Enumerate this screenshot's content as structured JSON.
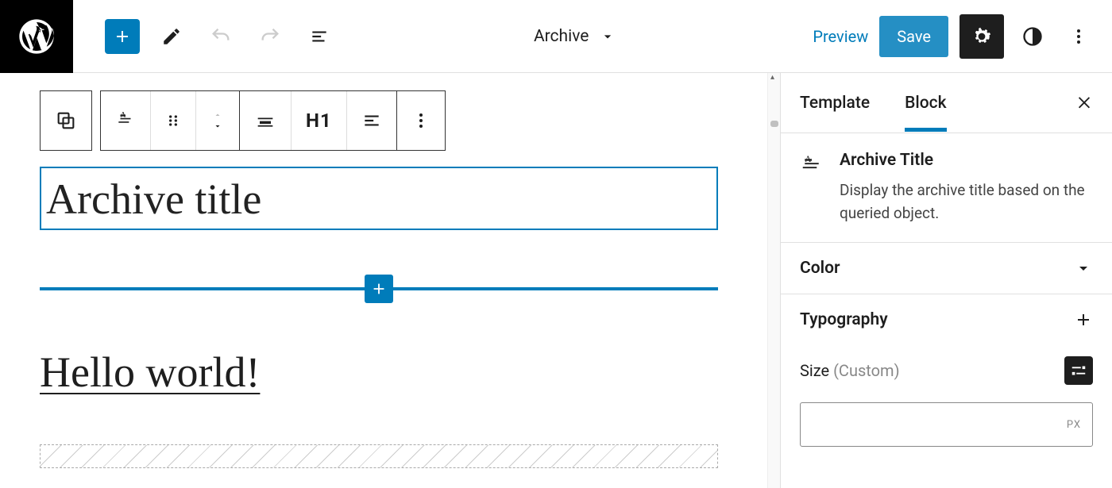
{
  "topbar": {
    "template_name": "Archive",
    "preview": "Preview",
    "save": "Save"
  },
  "canvas": {
    "heading_level": "H1",
    "archive_title": "Archive title",
    "post_title": "Hello world!"
  },
  "sidebar": {
    "tabs": {
      "template": "Template",
      "block": "Block"
    },
    "block_name": "Archive Title",
    "block_description": "Display the archive title based on the queried object.",
    "panels": {
      "color": "Color",
      "typography": "Typography"
    },
    "size": {
      "label": "Size",
      "mode": "(Custom)",
      "unit": "PX"
    }
  }
}
